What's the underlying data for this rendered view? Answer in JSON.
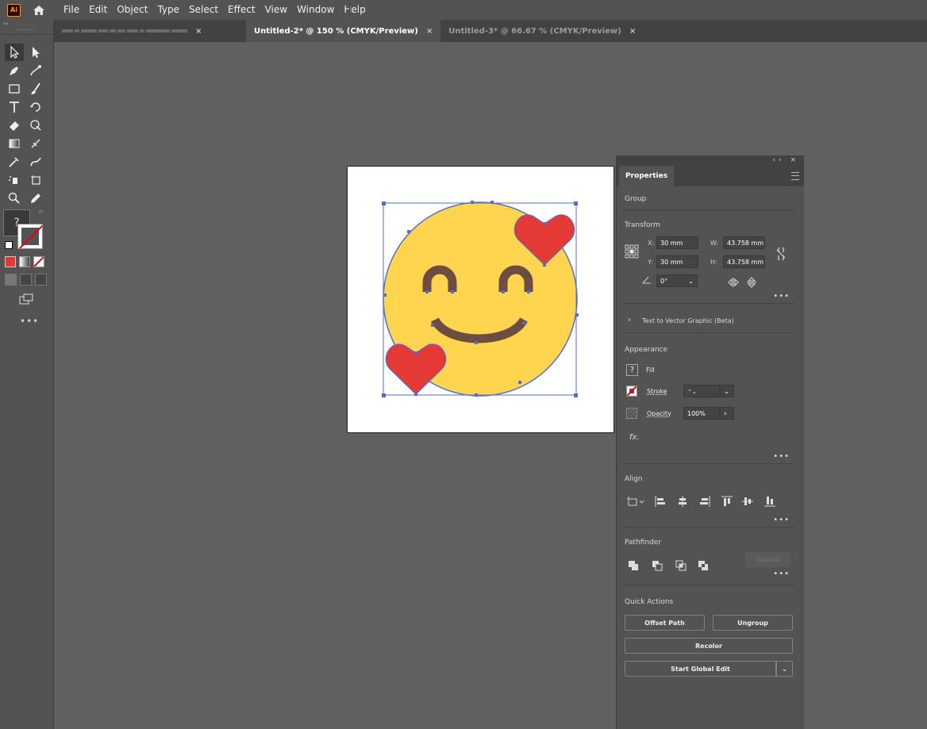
{
  "app": {
    "logo": "Ai"
  },
  "menu": [
    "File",
    "Edit",
    "Object",
    "Type",
    "Select",
    "Effect",
    "View",
    "Window",
    "Help"
  ],
  "tabs": [
    {
      "label": "",
      "close": "×"
    },
    {
      "label": "Untitled-2* @ 150 % (CMYK/Preview)",
      "close": "×"
    },
    {
      "label": "Untitled-3* @ 66.67 % (CMYK/Preview)",
      "close": "×"
    }
  ],
  "toolbar": {
    "collapse": "‹‹",
    "fill_label": "?",
    "more": "•••",
    "tools": [
      "selection-tool",
      "direct-selection-tool",
      "pen-tool",
      "curvature-tool",
      "rectangle-tool",
      "paintbrush-tool",
      "type-tool",
      "rotate-tool",
      "eraser-tool",
      "shape-builder-tool",
      "gradient-tool",
      "mesh-tool",
      "eyedropper-tool",
      "width-tool",
      "symbol-sprayer-tool",
      "artboard-tool",
      "zoom-tool",
      "pencil-tool"
    ]
  },
  "properties": {
    "tab": "Properties",
    "window_controls": "‹‹ ×",
    "object_type": "Group",
    "transform": {
      "title": "Transform",
      "x_label": "X:",
      "x": "30 mm",
      "y_label": "Y:",
      "y": "30 mm",
      "w_label": "W:",
      "w": "43.758 mm",
      "h_label": "H:",
      "h": "43.758 mm",
      "angle": "0°",
      "more": "•••"
    },
    "text_to_vector": "Text to Vector Graphic (Beta)",
    "appearance": {
      "title": "Appearance",
      "fill_label": "Fill",
      "fill_swatch": "?",
      "stroke_label": "Stroke",
      "opacity_label": "Opacity",
      "opacity": "100%",
      "fx": "fx.",
      "more": "•••"
    },
    "align": {
      "title": "Align",
      "more": "•••"
    },
    "pathfinder": {
      "title": "Pathfinder",
      "expand": "Expand",
      "more": "•••"
    },
    "quick_actions": {
      "title": "Quick Actions",
      "offset_path": "Offset Path",
      "ungroup": "Ungroup",
      "recolor": "Recolor",
      "start_global_edit": "Start Global Edit"
    }
  },
  "colors": {
    "face": "#ffd54f",
    "heart": "#e53935",
    "features": "#6d4c41",
    "selection": "#4f6fd0"
  }
}
